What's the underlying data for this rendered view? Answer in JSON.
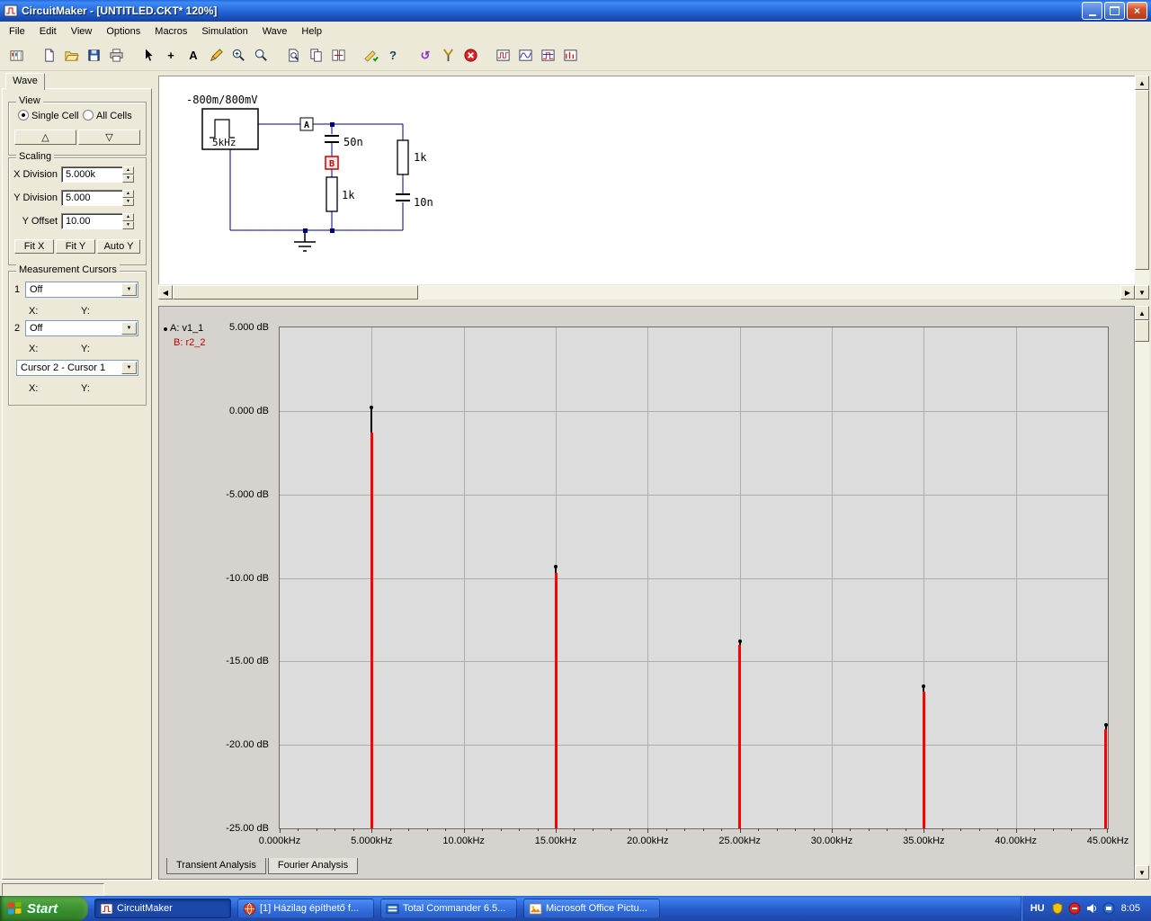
{
  "window": {
    "title": "CircuitMaker - [UNTITLED.CKT* 120%]"
  },
  "menu": {
    "items": [
      "File",
      "Edit",
      "View",
      "Options",
      "Macros",
      "Simulation",
      "Wave",
      "Help"
    ]
  },
  "toolbar": {
    "items": [
      {
        "name": "parts-bin-icon",
        "group": 1
      },
      {
        "name": "new-file-icon",
        "group": 2
      },
      {
        "name": "open-file-icon",
        "group": 2
      },
      {
        "name": "save-file-icon",
        "group": 2
      },
      {
        "name": "print-icon",
        "group": 2
      },
      {
        "name": "cursor-arrow-icon",
        "group": 3
      },
      {
        "name": "wire-tool-icon",
        "group": 3
      },
      {
        "name": "text-tool-icon",
        "group": 3
      },
      {
        "name": "pencil-tool-icon",
        "group": 3
      },
      {
        "name": "zoom-area-icon",
        "group": 3
      },
      {
        "name": "magnifier-icon",
        "group": 3
      },
      {
        "name": "find-device-icon",
        "group": 4
      },
      {
        "name": "copy-page-icon",
        "group": 4
      },
      {
        "name": "split-view-icon",
        "group": 4
      },
      {
        "name": "simulation-check-icon",
        "group": 5
      },
      {
        "name": "help-icon",
        "group": 5
      },
      {
        "name": "reset-icon",
        "group": 6
      },
      {
        "name": "probe-icon",
        "group": 6
      },
      {
        "name": "stop-icon",
        "group": 6
      },
      {
        "name": "scope-icon-1",
        "group": 7
      },
      {
        "name": "scope-icon-2",
        "group": 7
      },
      {
        "name": "scope-icon-3",
        "group": 7
      },
      {
        "name": "scope-icon-4",
        "group": 7
      }
    ]
  },
  "wave_panel": {
    "tab_label": "Wave",
    "view": {
      "title": "View",
      "options": [
        "Single Cell",
        "All Cells"
      ],
      "selected": "Single Cell",
      "up_glyph": "△",
      "down_glyph": "▽"
    },
    "scaling": {
      "title": "Scaling",
      "rows": [
        {
          "label": "X Division",
          "value": "5.000k"
        },
        {
          "label": "Y Division",
          "value": "5.000"
        },
        {
          "label": "Y Offset",
          "value": "10.00"
        }
      ],
      "buttons": [
        "Fit X",
        "Fit Y",
        "Auto Y"
      ]
    },
    "cursors": {
      "title": "Measurement Cursors",
      "cursor1_label": "1",
      "cursor1_value": "Off",
      "cursor2_label": "2",
      "cursor2_value": "Off",
      "diff_value": "Cursor 2 - Cursor 1",
      "x_label": "X:",
      "y_label": "Y:"
    }
  },
  "schematic": {
    "source_range": "-800m/800mV",
    "source_freq": "5kHz",
    "node_a": "A",
    "node_b": "B",
    "cap1": "50n",
    "res1": "1k",
    "res2": "1k",
    "cap2": "10n"
  },
  "chart_data": {
    "type": "bar",
    "title": "",
    "grid": true,
    "legend_position": "top-left",
    "xlim": [
      0,
      45
    ],
    "ylim": [
      -25,
      5
    ],
    "x_tick_values": [
      0,
      5,
      10,
      15,
      20,
      25,
      30,
      35,
      40,
      45
    ],
    "x_ticks": [
      "0.000kHz",
      "5.000kHz",
      "10.00kHz",
      "15.00kHz",
      "20.00kHz",
      "25.00kHz",
      "30.00kHz",
      "35.00kHz",
      "40.00kHz",
      "45.00kHz"
    ],
    "y_tick_values": [
      5,
      0,
      -5,
      -10,
      -15,
      -20,
      -25
    ],
    "y_ticks": [
      "5.000 dB",
      "0.000 dB",
      "-5.000 dB",
      "-10.00 dB",
      "-15.00 dB",
      "-20.00 dB",
      "-25.00 dB"
    ],
    "series": [
      {
        "name": "A: v1_1",
        "color": "#000000",
        "style": "impulse-dot",
        "x": [
          5,
          15,
          25,
          35,
          45
        ],
        "values": [
          0.2,
          -9.3,
          -13.8,
          -16.5,
          -18.8
        ]
      },
      {
        "name": "B: r2_2",
        "color": "#ff0000",
        "style": "impulse",
        "x": [
          5,
          15,
          25,
          35,
          45
        ],
        "values": [
          -1.3,
          -9.7,
          -14.0,
          -16.8,
          -19.1
        ]
      }
    ]
  },
  "wave_tabs": [
    {
      "label": "Transient Analysis",
      "active": false
    },
    {
      "label": "Fourier Analysis",
      "active": true
    }
  ],
  "taskbar": {
    "start_label": "Start",
    "buttons": [
      {
        "label": "CircuitMaker",
        "icon": "circuitmaker-task-icon",
        "active": true
      },
      {
        "label": "[1] Házilag építhető f...",
        "icon": "browser-task-icon",
        "active": false
      },
      {
        "label": "Total Commander 6.5...",
        "icon": "totalcmd-task-icon",
        "active": false
      },
      {
        "label": "Microsoft Office Pictu...",
        "icon": "picture-task-icon",
        "active": false
      }
    ],
    "language": "HU",
    "tray_icons": [
      "tray-shield-icon",
      "tray-msg-icon",
      "volume-icon",
      "tray-network-icon"
    ],
    "clock": "8:05"
  }
}
